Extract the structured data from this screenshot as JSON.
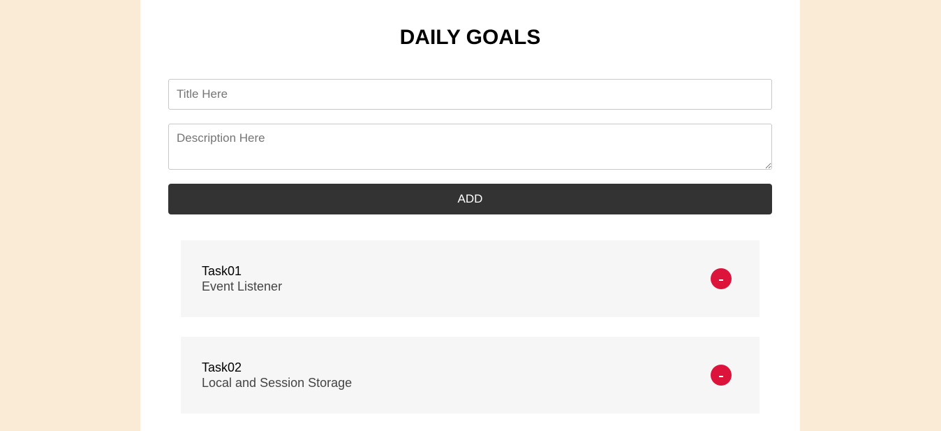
{
  "page": {
    "title": "DAILY GOALS",
    "colors": {
      "background": "#faebd7",
      "card": "#ffffff",
      "add_button": "#333333",
      "task_background": "#f6f6f6",
      "remove_button": "#dc143c"
    }
  },
  "form": {
    "title_placeholder": "Title Here",
    "title_value": "",
    "description_placeholder": "Description Here",
    "description_value": "",
    "add_label": "ADD"
  },
  "tasks": [
    {
      "title": "Task01",
      "description": "Event Listener",
      "remove_icon": "minus-icon"
    },
    {
      "title": "Task02",
      "description": "Local and Session Storage",
      "remove_icon": "minus-icon"
    }
  ]
}
